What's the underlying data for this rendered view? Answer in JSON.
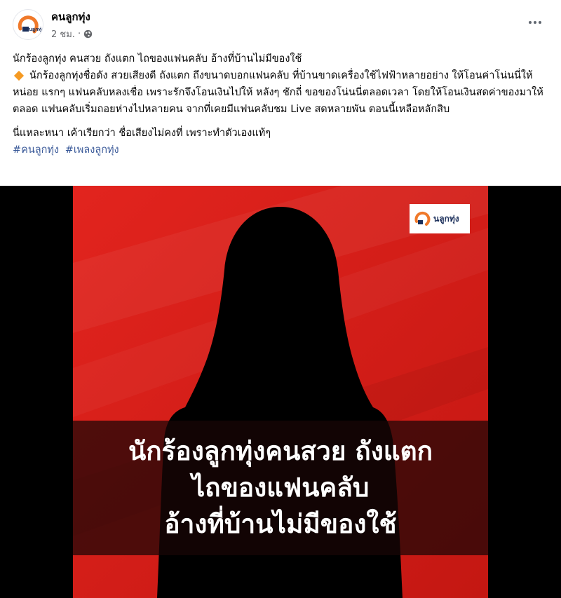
{
  "page": {
    "name": "คนลูกทุ่ง",
    "time": "2 ชม.",
    "separator": "·",
    "logo_text": "นลูกทุ่ง"
  },
  "post": {
    "headline": "นักร้องลูกทุ่ง คนสวย ถังแตก ไถของแฟนคลับ อ้างที่บ้านไม่มีของใช้",
    "body": "นักร้องลูกทุ่งชื่อดัง สวยเสียงดี ถังแตก ถึงขนาดบอกแฟนคลับ ที่บ้านขาดเครื่องใช้ไฟฟ้าหลายอย่าง ให้โอนค่าโน่นนี่ให้หน่อย แรกๆ แฟนคลับหลงเชื่อ เพราะรักจึงโอนเงินไปให้ หลังๆ ชักถี่ ขอของโน่นนี่ตลอดเวลา โดยให้โอนเงินสดค่าของมาให้ตลอด แฟนคลับเริ่มถอยห่างไปหลายคน จากที่เคยมีแฟนคลับชม Live สดหลายพัน ตอนนี้เหลือหลักสิบ",
    "closing": "นี่แหละหนา เค้าเรียกว่า ชื่อเสียงไม่คงที่ เพราะทำตัวเองแท้ๆ",
    "hashtags": [
      "#คนลูกทุ่ง",
      "#เพลงลูกทุ่ง"
    ]
  },
  "image": {
    "caption_line1": "นักร้องลูกทุ่งคนสวย ถังแตก",
    "caption_line2": "ไถของแฟนคลับ",
    "caption_line3": "อ้างที่บ้านไม่มีของใช้"
  },
  "icons": {
    "globe": "globe-icon",
    "more": "more-options-icon",
    "bullet": "orange-diamond-icon"
  },
  "colors": {
    "accent_red": "#d8201b",
    "logo_orange": "#f0792a",
    "hashtag_blue": "#385898",
    "meta_gray": "#65676b"
  }
}
